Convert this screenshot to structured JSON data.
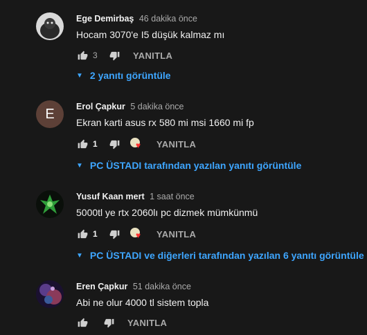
{
  "comments": [
    {
      "author": "Ege Demirbaş",
      "time": "46 dakika önce",
      "text": "Hocam 3070'e I5 düşük kalmaz mı",
      "likes": "3",
      "reply_label": "YANITLA",
      "replies_link": "2 yanıtı görüntüle"
    },
    {
      "avatar_letter": "E",
      "author": "Erol Çapkur",
      "time": "5 dakika önce",
      "text": "Ekran karti asus rx 580 mi msi 1660 mi fp",
      "likes": "1",
      "reply_label": "YANITLA",
      "replies_link": "PC ÜSTADI tarafından yazılan yanıtı görüntüle"
    },
    {
      "author": "Yusuf Kaan mert",
      "time": "1 saat önce",
      "text": "5000tl ye rtx 2060lı pc dizmek mümkünmü",
      "likes": "1",
      "reply_label": "YANITLA",
      "replies_link": "PC ÜSTADI ve diğerleri tarafından yazılan 6 yanıtı görüntüle"
    },
    {
      "author": "Eren Çapkur",
      "time": "51 dakika önce",
      "text": "Abi ne olur 4000 tl sistem topla",
      "reply_label": "YANITLA"
    }
  ],
  "icons": {
    "like": "thumb-up-icon",
    "dislike": "thumb-down-icon",
    "heart": "creator-heart-icon",
    "expand": "caret-down-icon"
  },
  "colors": {
    "background": "#181818",
    "link": "#3ea6ff",
    "heart": "#ff2d2d"
  }
}
